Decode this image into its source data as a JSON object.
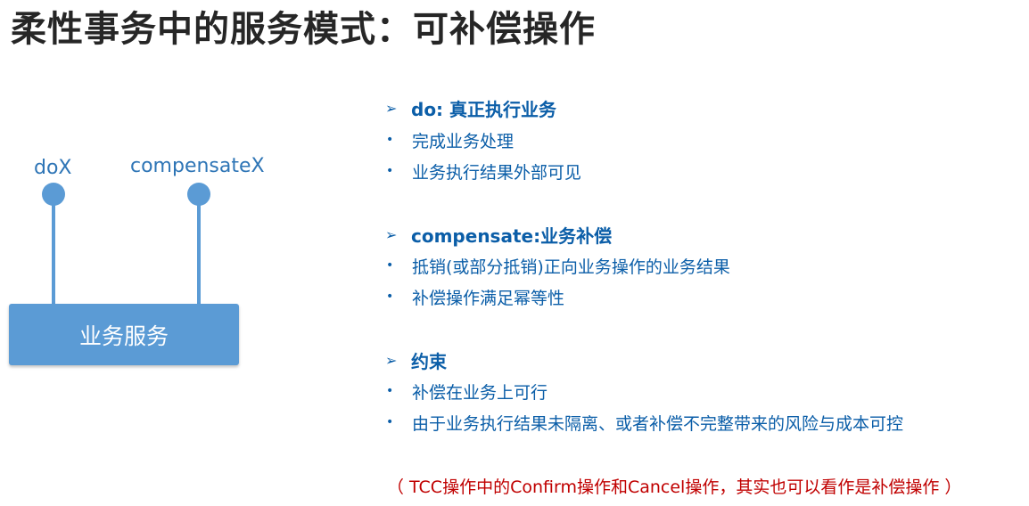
{
  "title": "柔性事务中的服务模式：可补偿操作",
  "diagram": {
    "pin_left_label": "doX",
    "pin_right_label": "compensateX",
    "service_box_label": "业务服务",
    "color": "#5b9bd5"
  },
  "sections": [
    {
      "heading": "do: 真正执行业务",
      "items": [
        "完成业务处理",
        "业务执行结果外部可见"
      ]
    },
    {
      "heading": "compensate:业务补偿",
      "items": [
        "抵销(或部分抵销)正向业务操作的业务结果",
        "补偿操作满足幂等性"
      ]
    },
    {
      "heading": "约束",
      "items": [
        "补偿在业务上可行",
        "由于业务执行结果未隔离、或者补偿不完整带来的风险与成本可控"
      ]
    }
  ],
  "note": "（ TCC操作中的Confirm操作和Cancel操作，其实也可以看作是补偿操作 ）",
  "colors": {
    "text_blue": "#0b5ea8",
    "note_red": "#c00000",
    "title": "#262626"
  },
  "icons": {
    "heading_marker": "arrow-bullet-icon",
    "item_marker": "dot-bullet-icon"
  }
}
